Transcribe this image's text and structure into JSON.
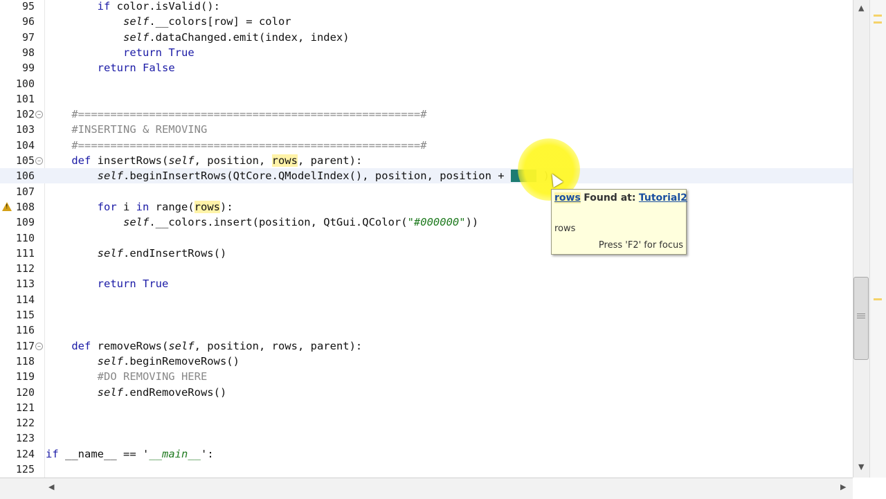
{
  "editor": {
    "lines": [
      {
        "num": "95",
        "fold": false,
        "warn": false,
        "current": false,
        "parts": [
          [
            "        ",
            ""
          ],
          [
            "if",
            "kw"
          ],
          [
            " color.isValid():",
            ""
          ]
        ]
      },
      {
        "num": "96",
        "fold": false,
        "warn": false,
        "current": false,
        "parts": [
          [
            "            ",
            ""
          ],
          [
            "self",
            "self"
          ],
          [
            ".__colors[row] = color",
            ""
          ]
        ]
      },
      {
        "num": "97",
        "fold": false,
        "warn": false,
        "current": false,
        "parts": [
          [
            "            ",
            ""
          ],
          [
            "self",
            "self"
          ],
          [
            ".dataChanged.emit(index, index)",
            ""
          ]
        ]
      },
      {
        "num": "98",
        "fold": false,
        "warn": false,
        "current": false,
        "parts": [
          [
            "            ",
            ""
          ],
          [
            "return",
            "kw"
          ],
          [
            " ",
            ""
          ],
          [
            "True",
            "kw"
          ]
        ]
      },
      {
        "num": "99",
        "fold": false,
        "warn": false,
        "current": false,
        "parts": [
          [
            "        ",
            ""
          ],
          [
            "return",
            "kw"
          ],
          [
            " ",
            ""
          ],
          [
            "False",
            "kw"
          ]
        ]
      },
      {
        "num": "100",
        "fold": false,
        "warn": false,
        "current": false,
        "parts": []
      },
      {
        "num": "101",
        "fold": false,
        "warn": false,
        "current": false,
        "parts": []
      },
      {
        "num": "102",
        "fold": true,
        "warn": false,
        "current": false,
        "parts": [
          [
            "    ",
            ""
          ],
          [
            "#=====================================================#",
            "cmt"
          ]
        ]
      },
      {
        "num": "103",
        "fold": false,
        "warn": false,
        "current": false,
        "parts": [
          [
            "    ",
            ""
          ],
          [
            "#INSERTING & REMOVING",
            "cmt"
          ]
        ]
      },
      {
        "num": "104",
        "fold": false,
        "warn": false,
        "current": false,
        "parts": [
          [
            "    ",
            ""
          ],
          [
            "#=====================================================#",
            "cmt"
          ]
        ]
      },
      {
        "num": "105",
        "fold": true,
        "warn": false,
        "current": false,
        "parts": [
          [
            "    ",
            ""
          ],
          [
            "def",
            "kw"
          ],
          [
            " insertRows(",
            ""
          ],
          [
            "self",
            "self"
          ],
          [
            ", position, ",
            ""
          ],
          [
            "rows",
            "hl"
          ],
          [
            ", parent):",
            ""
          ]
        ]
      },
      {
        "num": "106",
        "fold": false,
        "warn": false,
        "current": true,
        "parts": [
          [
            "        ",
            ""
          ],
          [
            "self",
            "self"
          ],
          [
            ".beginInsertRows(QtCore.QModelIndex(), position, position + ",
            ""
          ],
          [
            "rows",
            "sel"
          ],
          [
            " )",
            ""
          ]
        ]
      },
      {
        "num": "107",
        "fold": false,
        "warn": false,
        "current": false,
        "parts": []
      },
      {
        "num": "108",
        "fold": false,
        "warn": true,
        "current": false,
        "parts": [
          [
            "        ",
            ""
          ],
          [
            "for",
            "kw"
          ],
          [
            " i ",
            ""
          ],
          [
            "in",
            "kw"
          ],
          [
            " range(",
            ""
          ],
          [
            "rows",
            "hl"
          ],
          [
            "):",
            ""
          ]
        ]
      },
      {
        "num": "109",
        "fold": false,
        "warn": false,
        "current": false,
        "parts": [
          [
            "            ",
            ""
          ],
          [
            "self",
            "self"
          ],
          [
            ".__colors.insert(position, QtGui.QColor(",
            ""
          ],
          [
            "\"#000000\"",
            "str"
          ],
          [
            "))",
            ""
          ]
        ]
      },
      {
        "num": "110",
        "fold": false,
        "warn": false,
        "current": false,
        "parts": []
      },
      {
        "num": "111",
        "fold": false,
        "warn": false,
        "current": false,
        "parts": [
          [
            "        ",
            ""
          ],
          [
            "self",
            "self"
          ],
          [
            ".endInsertRows()",
            ""
          ]
        ]
      },
      {
        "num": "112",
        "fold": false,
        "warn": false,
        "current": false,
        "parts": []
      },
      {
        "num": "113",
        "fold": false,
        "warn": false,
        "current": false,
        "parts": [
          [
            "        ",
            ""
          ],
          [
            "return",
            "kw"
          ],
          [
            " ",
            ""
          ],
          [
            "True",
            "kw"
          ]
        ]
      },
      {
        "num": "114",
        "fold": false,
        "warn": false,
        "current": false,
        "parts": []
      },
      {
        "num": "115",
        "fold": false,
        "warn": false,
        "current": false,
        "parts": []
      },
      {
        "num": "116",
        "fold": false,
        "warn": false,
        "current": false,
        "parts": []
      },
      {
        "num": "117",
        "fold": true,
        "warn": false,
        "current": false,
        "parts": [
          [
            "    ",
            ""
          ],
          [
            "def",
            "kw"
          ],
          [
            " removeRows(",
            ""
          ],
          [
            "self",
            "self"
          ],
          [
            ", position, rows, parent):",
            ""
          ]
        ]
      },
      {
        "num": "118",
        "fold": false,
        "warn": false,
        "current": false,
        "parts": [
          [
            "        ",
            ""
          ],
          [
            "self",
            "self"
          ],
          [
            ".beginRemoveRows()",
            ""
          ]
        ]
      },
      {
        "num": "119",
        "fold": false,
        "warn": false,
        "current": false,
        "parts": [
          [
            "        ",
            ""
          ],
          [
            "#DO REMOVING HERE",
            "cmt"
          ]
        ]
      },
      {
        "num": "120",
        "fold": false,
        "warn": false,
        "current": false,
        "parts": [
          [
            "        ",
            ""
          ],
          [
            "self",
            "self"
          ],
          [
            ".endRemoveRows()",
            ""
          ]
        ]
      },
      {
        "num": "121",
        "fold": false,
        "warn": false,
        "current": false,
        "parts": []
      },
      {
        "num": "122",
        "fold": false,
        "warn": false,
        "current": false,
        "parts": []
      },
      {
        "num": "123",
        "fold": false,
        "warn": false,
        "current": false,
        "parts": []
      },
      {
        "num": "124",
        "fold": false,
        "warn": false,
        "current": false,
        "parts": [
          [
            "if",
            "kw"
          ],
          [
            " __name__ == '",
            ""
          ],
          [
            "__main__",
            "str"
          ],
          [
            "':",
            ""
          ]
        ]
      },
      {
        "num": "125",
        "fold": false,
        "warn": false,
        "current": false,
        "parts": []
      }
    ]
  },
  "tooltip": {
    "word": "rows",
    "found_label": "Found at:",
    "link": "Tutorial2",
    "doc": "rows",
    "footer": "Press 'F2' for focus"
  },
  "icons": {
    "warning": "warning-icon",
    "fold": "fold-toggle-icon",
    "scroll_up": "chevron-up-icon",
    "scroll_down": "chevron-down-icon",
    "scroll_left": "chevron-left-icon",
    "scroll_right": "chevron-right-icon"
  },
  "colors": {
    "keyword": "#1a1aa6",
    "occurrence_highlight": "#fff3a8",
    "selection": "#1d7c73",
    "cursor_halo": "#fff728",
    "marker": "#f5d36a"
  },
  "overview_marks": [
    {
      "pos": 0.03
    },
    {
      "pos": 0.045
    },
    {
      "pos": 0.625
    }
  ]
}
